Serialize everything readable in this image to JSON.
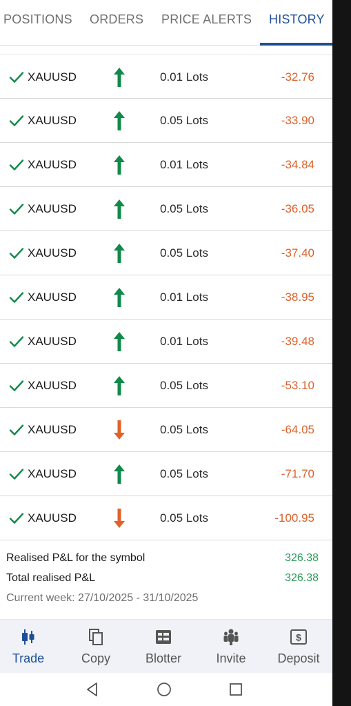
{
  "tabs": [
    {
      "label": "POSITIONS",
      "active": false
    },
    {
      "label": "ORDERS",
      "active": false
    },
    {
      "label": "PRICE ALERTS",
      "active": false
    },
    {
      "label": "HISTORY",
      "active": true
    }
  ],
  "history": [
    {
      "symbol": "XAUUSD",
      "direction": "up",
      "lots": "0.01 Lots",
      "pnl": "-32.76"
    },
    {
      "symbol": "XAUUSD",
      "direction": "up",
      "lots": "0.05 Lots",
      "pnl": "-33.90"
    },
    {
      "symbol": "XAUUSD",
      "direction": "up",
      "lots": "0.01 Lots",
      "pnl": "-34.84"
    },
    {
      "symbol": "XAUUSD",
      "direction": "up",
      "lots": "0.05 Lots",
      "pnl": "-36.05"
    },
    {
      "symbol": "XAUUSD",
      "direction": "up",
      "lots": "0.05 Lots",
      "pnl": "-37.40"
    },
    {
      "symbol": "XAUUSD",
      "direction": "up",
      "lots": "0.01 Lots",
      "pnl": "-38.95"
    },
    {
      "symbol": "XAUUSD",
      "direction": "up",
      "lots": "0.01 Lots",
      "pnl": "-39.48"
    },
    {
      "symbol": "XAUUSD",
      "direction": "up",
      "lots": "0.05 Lots",
      "pnl": "-53.10"
    },
    {
      "symbol": "XAUUSD",
      "direction": "down",
      "lots": "0.05 Lots",
      "pnl": "-64.05"
    },
    {
      "symbol": "XAUUSD",
      "direction": "up",
      "lots": "0.05 Lots",
      "pnl": "-71.70"
    },
    {
      "symbol": "XAUUSD",
      "direction": "down",
      "lots": "0.05 Lots",
      "pnl": "-100.95"
    }
  ],
  "summary": {
    "symbol_label": "Realised P&L for the symbol",
    "symbol_value": "326.38",
    "total_label": "Total realised P&L",
    "total_value": "326.38",
    "week": "Current week: 27/10/2025 - 31/10/2025"
  },
  "bottom_nav": [
    {
      "label": "Trade",
      "icon": "candlestick-icon",
      "active": true
    },
    {
      "label": "Copy",
      "icon": "copy-icon",
      "active": false
    },
    {
      "label": "Blotter",
      "icon": "blotter-icon",
      "active": false
    },
    {
      "label": "Invite",
      "icon": "people-icon",
      "active": false
    },
    {
      "label": "Deposit",
      "icon": "deposit-icon",
      "active": false
    }
  ],
  "system_nav": [
    "back-icon",
    "home-icon",
    "recents-icon"
  ],
  "colors": {
    "accent": "#1f4e96",
    "up": "#12894a",
    "down": "#e0622a",
    "loss": "#d9622b",
    "profit": "#2e9a5a"
  }
}
